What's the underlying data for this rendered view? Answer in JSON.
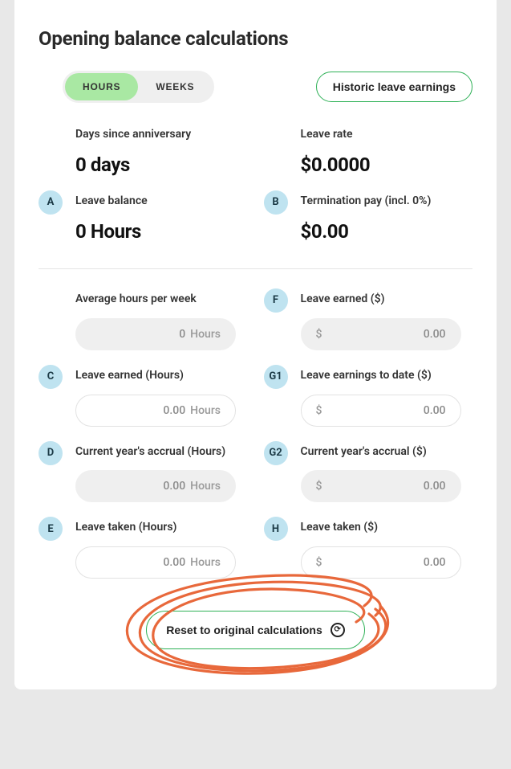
{
  "title": "Opening balance calculations",
  "segmented": {
    "hours": "HOURS",
    "weeks": "WEEKS",
    "active": "hours"
  },
  "historic_button": "Historic leave earnings",
  "reset_button": "Reset to original calculations",
  "summary": {
    "days_since_anniversary": {
      "label": "Days since anniversary",
      "value": "0 days"
    },
    "leave_rate": {
      "label": "Leave rate",
      "value": "$0.0000"
    },
    "leave_balance": {
      "badge": "A",
      "label": "Leave balance",
      "value": "0 Hours"
    },
    "termination_pay": {
      "badge": "B",
      "label": "Termination pay (incl. 0%)",
      "value": "$0.00"
    }
  },
  "fields": {
    "avg_hours_per_week": {
      "label": "Average hours per week",
      "value": "0",
      "suffix": "Hours",
      "readonly": true
    },
    "leave_earned_dollars": {
      "badge": "F",
      "label": "Leave earned ($)",
      "prefix": "$",
      "value": "0.00",
      "readonly": true
    },
    "leave_earned_hours": {
      "badge": "C",
      "label": "Leave earned (Hours)",
      "value": "0.00",
      "suffix": "Hours",
      "readonly": false
    },
    "leave_earnings_to_date": {
      "badge": "G1",
      "label": "Leave earnings to date ($)",
      "prefix": "$",
      "value": "0.00",
      "readonly": false
    },
    "current_accrual_hours": {
      "badge": "D",
      "label": "Current year's accrual (Hours)",
      "value": "0.00",
      "suffix": "Hours",
      "readonly": true
    },
    "current_accrual_dollars": {
      "badge": "G2",
      "label": "Current year's accrual ($)",
      "prefix": "$",
      "value": "0.00",
      "readonly": true
    },
    "leave_taken_hours": {
      "badge": "E",
      "label": "Leave taken (Hours)",
      "value": "0.00",
      "suffix": "Hours",
      "readonly": false
    },
    "leave_taken_dollars": {
      "badge": "H",
      "label": "Leave taken ($)",
      "prefix": "$",
      "value": "0.00",
      "readonly": false
    }
  }
}
